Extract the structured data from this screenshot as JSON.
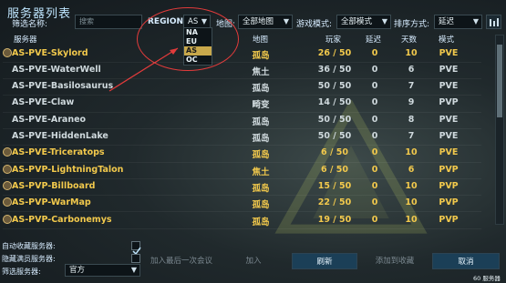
{
  "title": "服务器列表",
  "filter": {
    "name_label": "筛选名称:",
    "search_placeholder": "搜索",
    "region_label": "REGION:",
    "region_value": "AS",
    "region_options": [
      "NA",
      "EU",
      "AS",
      "OC"
    ],
    "map_label": "地图:",
    "map_value": "全部地图",
    "mode_label": "游戏模式:",
    "mode_value": "全部模式",
    "sort_label": "排序方式:",
    "sort_value": "延迟"
  },
  "columns": {
    "server": "服务器",
    "map": "地图",
    "players": "玩家",
    "ping": "延迟",
    "days": "天数",
    "mode": "模式"
  },
  "servers": [
    {
      "name": "AS-PVE-Skylord",
      "map": "孤岛",
      "players": "26 / 50",
      "ping": "0",
      "days": "10",
      "mode": "PVE",
      "tag": true,
      "color": "#f2c94c"
    },
    {
      "name": "AS-PVE-WaterWell",
      "map": "焦土",
      "players": "36 / 50",
      "ping": "0",
      "days": "6",
      "mode": "PVE",
      "tag": false,
      "color": "#cfd9dd"
    },
    {
      "name": "AS-PVE-Basilosaurus",
      "map": "孤岛",
      "players": "50 / 50",
      "ping": "0",
      "days": "7",
      "mode": "PVE",
      "tag": false,
      "color": "#cfd9dd"
    },
    {
      "name": "AS-PVE-Claw",
      "map": "畸变",
      "players": "14 / 50",
      "ping": "0",
      "days": "9",
      "mode": "PVP",
      "tag": false,
      "color": "#cfd9dd"
    },
    {
      "name": "AS-PVE-Araneo",
      "map": "孤岛",
      "players": "50 / 50",
      "ping": "0",
      "days": "8",
      "mode": "PVE",
      "tag": false,
      "color": "#cfd9dd"
    },
    {
      "name": "AS-PVE-HiddenLake",
      "map": "孤岛",
      "players": "50 / 50",
      "ping": "0",
      "days": "7",
      "mode": "PVE",
      "tag": false,
      "color": "#cfd9dd"
    },
    {
      "name": "AS-PVE-Triceratops",
      "map": "孤岛",
      "players": "6 / 50",
      "ping": "0",
      "days": "10",
      "mode": "PVE",
      "tag": true,
      "color": "#f2c94c"
    },
    {
      "name": "AS-PVP-LightningTalon",
      "map": "焦土",
      "players": "6 / 50",
      "ping": "0",
      "days": "6",
      "mode": "PVP",
      "tag": true,
      "color": "#f2c94c"
    },
    {
      "name": "AS-PVP-Billboard",
      "map": "孤岛",
      "players": "15 / 50",
      "ping": "0",
      "days": "10",
      "mode": "PVP",
      "tag": true,
      "color": "#f2c94c"
    },
    {
      "name": "AS-PVP-WarMap",
      "map": "孤岛",
      "players": "22 / 50",
      "ping": "0",
      "days": "10",
      "mode": "PVP",
      "tag": true,
      "color": "#f2c94c"
    },
    {
      "name": "AS-PVP-Carbonemys",
      "map": "孤岛",
      "players": "19 / 50",
      "ping": "0",
      "days": "10",
      "mode": "PVP",
      "tag": true,
      "color": "#f2c94c"
    }
  ],
  "bottom": {
    "auto_fav": "自动收藏服务器:",
    "hide_full": "隐藏满员服务器:",
    "filter_server": "筛选服务器:",
    "filter_value": "官方",
    "join_last": "加入最后一次会议",
    "join": "加入",
    "refresh": "刷新",
    "add_fav": "添加到收藏",
    "cancel": "取消",
    "count": "60 服务器"
  }
}
